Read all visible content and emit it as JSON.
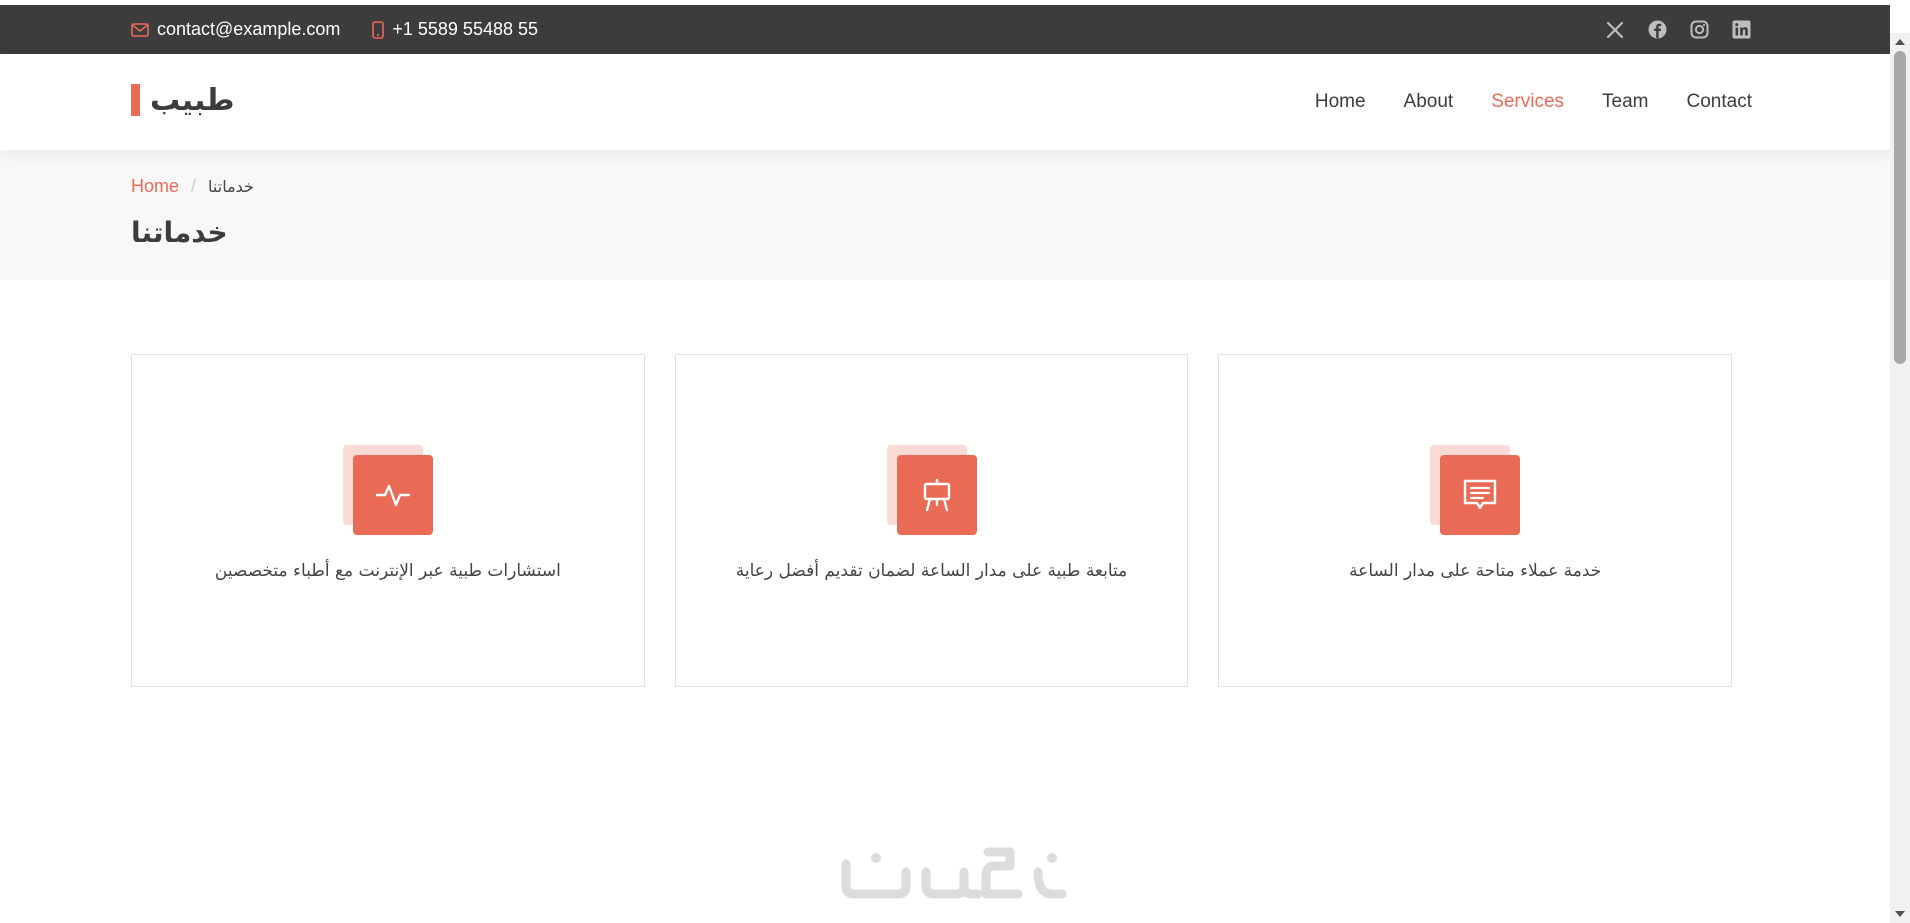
{
  "topbar": {
    "email": "contact@example.com",
    "phone": "+1 5589 55488 55",
    "email_icon": "envelope-icon",
    "phone_icon": "phone-icon",
    "social": [
      "x-twitter-icon",
      "facebook-icon",
      "instagram-icon",
      "linkedin-icon"
    ]
  },
  "header": {
    "logo": "طبيب",
    "nav": [
      {
        "label": "Home",
        "active": false
      },
      {
        "label": "About",
        "active": false
      },
      {
        "label": "Services",
        "active": true
      },
      {
        "label": "Team",
        "active": false
      },
      {
        "label": "Contact",
        "active": false
      }
    ]
  },
  "breadcrumbs": {
    "home": "Home",
    "separator": "/",
    "current": "خدماتنا",
    "title": "خدماتنا"
  },
  "services": [
    {
      "icon": "activity-icon",
      "text": "استشارات طبية عبر الإنترنت مع أطباء متخصصين"
    },
    {
      "icon": "easel-icon",
      "text": "متابعة طبية على مدار الساعة لضمان تقديم أفضل رعاية"
    },
    {
      "icon": "chat-icon",
      "text": "خدمة عملاء متاحة على مدار الساعة"
    }
  ],
  "colors": {
    "accent": "#e96b56",
    "accent_light": "#fadad4",
    "topbar_bg": "#3c3c3c",
    "breadcrumb_bg": "#f8f8f8"
  },
  "watermark": "خمسات"
}
